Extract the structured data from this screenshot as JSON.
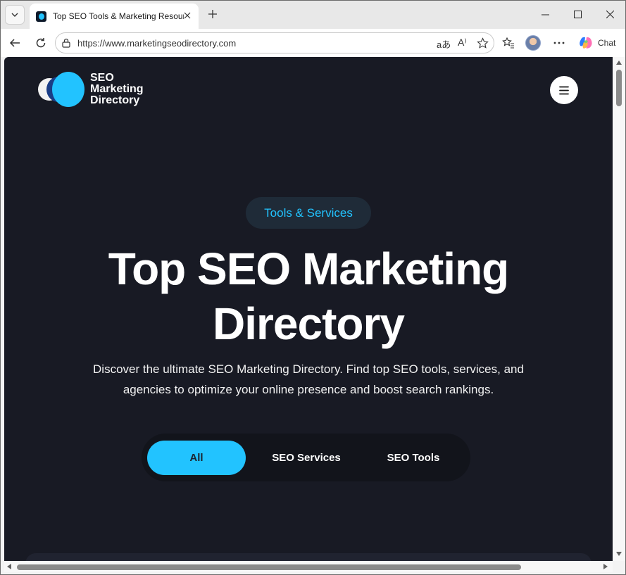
{
  "browser": {
    "tab_title": "Top SEO Tools & Marketing Resources",
    "url": "https://www.marketingseodirectory.com",
    "chat_label": "Chat",
    "icons": [
      "tab-list-icon",
      "close-tab-icon",
      "new-tab-icon",
      "minimize-icon",
      "maximize-icon",
      "close-window-icon",
      "back-icon",
      "refresh-icon",
      "site-info-icon",
      "translate-icon",
      "read-aloud-icon",
      "favorite-star-icon",
      "favorites-icon",
      "profile-avatar",
      "more-icon",
      "copilot-icon"
    ]
  },
  "site": {
    "logo_lines": [
      "SEO",
      "Marketing",
      "Directory"
    ],
    "menu_icon": "hamburger-icon",
    "badge": "Tools & Services",
    "title_line1": "Top SEO Marketing",
    "title_line2": "Directory",
    "subtitle": "Discover the ultimate SEO Marketing Directory. Find top SEO tools, services, and agencies to optimize your online presence and boost search rankings.",
    "filters": [
      {
        "label": "All",
        "active": true
      },
      {
        "label": "SEO Services",
        "active": false
      },
      {
        "label": "SEO Tools",
        "active": false
      }
    ]
  },
  "colors": {
    "page_bg": "#181a24",
    "accent": "#22c3ff",
    "badge_bg": "#1f2b38"
  }
}
